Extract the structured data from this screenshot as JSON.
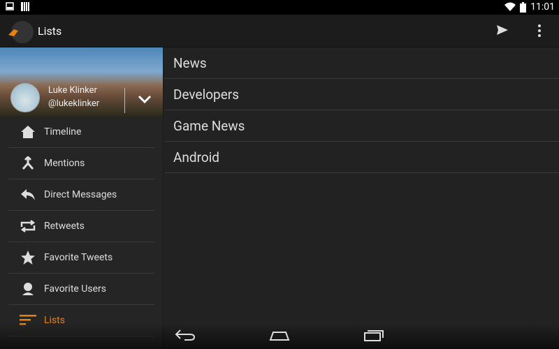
{
  "status": {
    "time": "11:01"
  },
  "appbar": {
    "title": "Lists"
  },
  "drawer": {
    "user": {
      "name": "Luke Klinker",
      "handle": "@lukeklinker"
    },
    "items": [
      {
        "label": "Timeline",
        "icon": "home-icon"
      },
      {
        "label": "Mentions",
        "icon": "mentions-icon"
      },
      {
        "label": "Direct Messages",
        "icon": "reply-icon"
      },
      {
        "label": "Retweets",
        "icon": "retweet-icon"
      },
      {
        "label": "Favorite Tweets",
        "icon": "star-icon"
      },
      {
        "label": "Favorite Users",
        "icon": "user-icon"
      },
      {
        "label": "Lists",
        "icon": "list-icon",
        "active": true
      }
    ]
  },
  "lists": [
    "News",
    "Developers",
    "Game News",
    "Android"
  ],
  "colors": {
    "accent": "#e8820e",
    "background": "#222222"
  }
}
